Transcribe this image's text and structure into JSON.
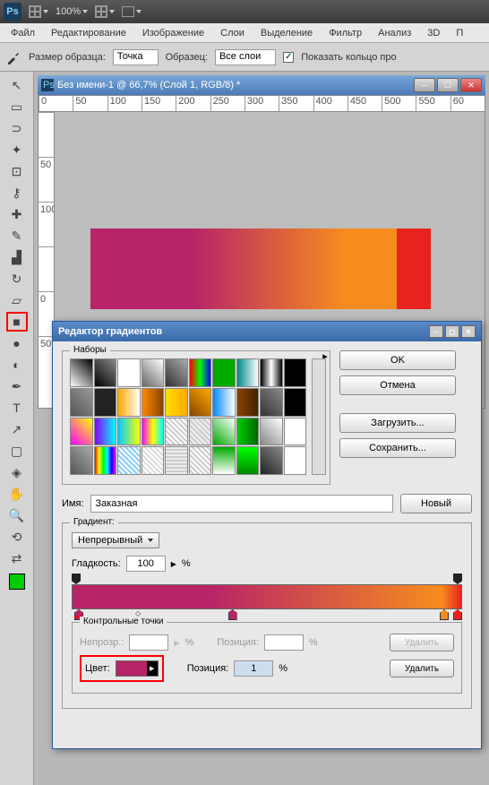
{
  "app": {
    "logo": "Ps",
    "zoom": "100%"
  },
  "menubar": [
    "Файл",
    "Редактирование",
    "Изображение",
    "Слои",
    "Выделение",
    "Фильтр",
    "Анализ",
    "3D",
    "П"
  ],
  "options": {
    "sample_label": "Размер образца:",
    "sample_value": "Точка",
    "source_label": "Образец:",
    "source_value": "Все слои",
    "ring_label": "Показать кольцо про"
  },
  "doc": {
    "title": "Без имени-1 @ 66,7% (Слой 1, RGB/8) *"
  },
  "ruler_h": [
    "0",
    "50",
    "100",
    "150",
    "200",
    "250",
    "300",
    "350",
    "400",
    "450",
    "500",
    "550",
    "60"
  ],
  "ruler_v": [
    "",
    "50",
    "100",
    "",
    "0",
    "50"
  ],
  "dialog": {
    "title": "Редактор градиентов",
    "presets_label": "Наборы",
    "ok": "OK",
    "cancel": "Отмена",
    "load": "Загрузить...",
    "save": "Сохранить...",
    "name_label": "Имя:",
    "name_value": "Заказная",
    "new_btn": "Новый",
    "grad_type_label": "Градиент:",
    "grad_type": "Непрерывный",
    "smooth_label": "Гладкость:",
    "smooth_value": "100",
    "pct": "%",
    "ctrl_label": "Контрольные точки",
    "opacity_label": "Непрозр.:",
    "pos_label": "Позиция:",
    "pos_value": "1",
    "color_label": "Цвет:",
    "delete": "Удалить"
  },
  "swatches": [
    "linear-gradient(45deg,#fff,#000)",
    "linear-gradient(45deg,#000,#888)",
    "linear-gradient(90deg,#fff,#fff)",
    "linear-gradient(45deg,#666,#fff)",
    "linear-gradient(45deg,#333,#aaa)",
    "linear-gradient(90deg,#f00,#0f0,#00f)",
    "#0a0",
    "linear-gradient(90deg,#088,#fff)",
    "linear-gradient(90deg,#000,#fff,#000)",
    "#000",
    "linear-gradient(45deg,#555,#999)",
    "#222",
    "linear-gradient(90deg,#fa0,#fff)",
    "linear-gradient(90deg,#f80,#840)",
    "linear-gradient(90deg,#fd0,#fa0)",
    "linear-gradient(45deg,#840,#fa0)",
    "linear-gradient(90deg,#08f,#fff)",
    "linear-gradient(90deg,#840,#420)",
    "linear-gradient(45deg,#333,#888)",
    "#000",
    "linear-gradient(45deg,#f0f,#ff0)",
    "linear-gradient(90deg,#80f,#0ff)",
    "linear-gradient(90deg,#0cf,#ff0)",
    "linear-gradient(90deg,#f0f,#ff0,#0ff)",
    "repeating-linear-gradient(45deg,#fff,#fff 2px,#ccc 2px,#ccc 4px)",
    "repeating-linear-gradient(45deg,#eee,#eee 2px,#ccc 2px,#ccc 4px)",
    "linear-gradient(45deg,#0a0,#fff)",
    "linear-gradient(90deg,#0c0,#060)",
    "linear-gradient(45deg,#888,#fff)",
    "#fff",
    "linear-gradient(45deg,#555,#aaa)",
    "linear-gradient(90deg,#f00,#ff0,#0f0,#0ff,#00f,#f0f)",
    "repeating-linear-gradient(45deg,#fff,#fff 2px,#8cf 2px,#8cf 4px)",
    "repeating-linear-gradient(45deg,#fff,#fff 2px,#ddd 2px,#ddd 4px)",
    "repeating-linear-gradient(0deg,#eee,#eee 2px,#ccc 2px,#ccc 4px)",
    "repeating-linear-gradient(45deg,#fff,#fff 2px,#ccc 2px,#ccc 4px)",
    "linear-gradient(180deg,#0a0,#fff)",
    "linear-gradient(180deg,#0f0,#080)",
    "linear-gradient(45deg,#222,#888)",
    "#fff"
  ]
}
